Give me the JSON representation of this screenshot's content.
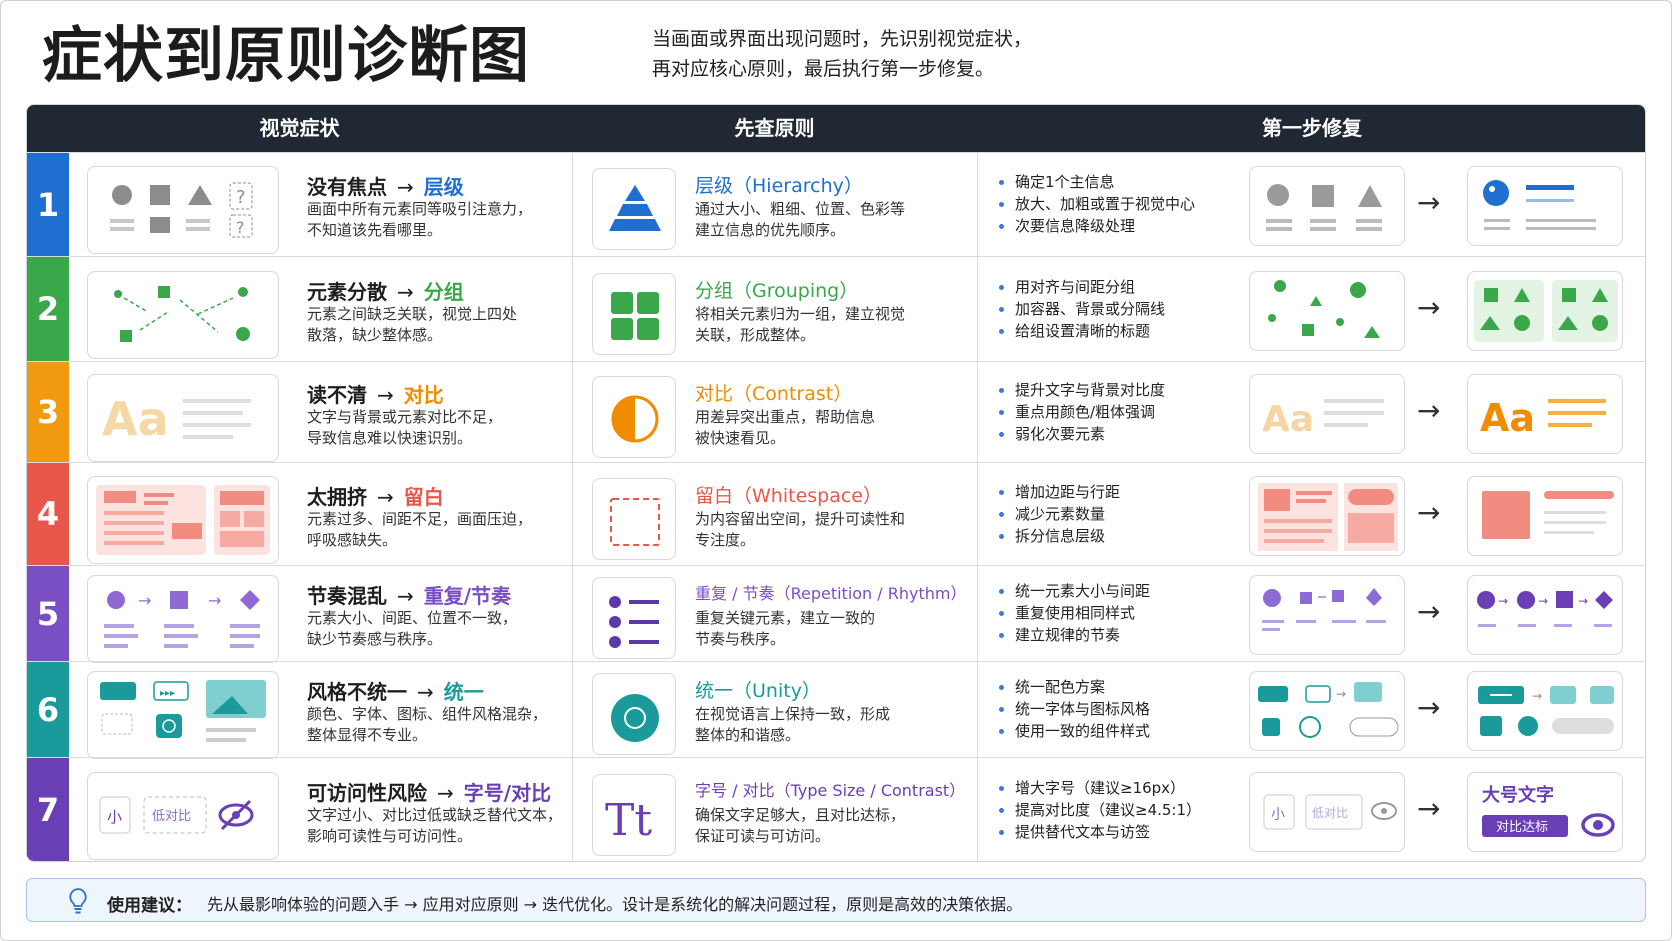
{
  "title": "症状到原则诊断图",
  "subtitle": [
    "当画面或界面出现问题时，先识别视觉症状，",
    "再对应核心原则，最后执行第一步修复。"
  ],
  "headers": {
    "symptom": "视觉症状",
    "principle": "先查原则",
    "fix": "第一步修复"
  },
  "rows": [
    {
      "num": "1",
      "color": "#1e6fd0",
      "accent": "#1e6fd0",
      "symptom": "没有焦点",
      "arrow": "→",
      "target": "层级",
      "desc": [
        "画面中所有元素同等吸引注意力，",
        "不知道该先看哪里。"
      ],
      "principle_name": "层级",
      "principle_en": "（Hierarchy）",
      "principle_desc": [
        "通过大小、粗细、位置、色彩等",
        "建立信息的优先顺序。"
      ],
      "fixes": [
        "确定1个主信息",
        "放大、加粗或置于视觉中心",
        "次要信息降级处理"
      ],
      "fix_arrow": "→"
    },
    {
      "num": "2",
      "color": "#3aa84a",
      "accent": "#3aa84a",
      "symptom": "元素分散",
      "arrow": "→",
      "target": "分组",
      "desc": [
        "元素之间缺乏关联，视觉上四处",
        "散落，缺少整体感。"
      ],
      "principle_name": "分组",
      "principle_en": "（Grouping）",
      "principle_desc": [
        "将相关元素归为一组，建立视觉",
        "关联，形成整体。"
      ],
      "fixes": [
        "用对齐与间距分组",
        "加容器、背景或分隔线",
        "给组设置清晰的标题"
      ],
      "fix_arrow": "→"
    },
    {
      "num": "3",
      "color": "#f29a0f",
      "accent": "#f08c00",
      "symptom": "读不清",
      "arrow": "→",
      "target": "对比",
      "desc": [
        "文字与背景或元素对比不足，",
        "导致信息难以快速识别。"
      ],
      "principle_name": "对比",
      "principle_en": "（Contrast）",
      "principle_desc": [
        "用差异突出重点，帮助信息",
        "被快速看见。"
      ],
      "fixes": [
        "提升文字与背景对比度",
        "重点用颜色/粗体强调",
        "弱化次要元素"
      ],
      "fix_arrow": "→",
      "aa": "Aa"
    },
    {
      "num": "4",
      "color": "#e8574a",
      "accent": "#e8574a",
      "symptom": "太拥挤",
      "arrow": "→",
      "target": "留白",
      "desc": [
        "元素过多、间距不足，画面压迫，",
        "呼吸感缺失。"
      ],
      "principle_name": "留白",
      "principle_en": "（Whitespace）",
      "principle_desc": [
        "为内容留出空间，提升可读性和",
        "专注度。"
      ],
      "fixes": [
        "增加边距与行距",
        "减少元素数量",
        "拆分信息层级"
      ],
      "fix_arrow": "→"
    },
    {
      "num": "5",
      "color": "#7b4fc4",
      "accent": "#7b4fc4",
      "symptom": "节奏混乱",
      "arrow": "→",
      "target": "重复/节奏",
      "desc": [
        "元素大小、间距、位置不一致，",
        "缺少节奏感与秩序。"
      ],
      "principle_name": "重复 / 节奏",
      "principle_en": "（Repetition / Rhythm）",
      "principle_desc": [
        "重复关键元素，建立一致的",
        "节奏与秩序。"
      ],
      "fixes": [
        "统一元素大小与间距",
        "重复使用相同样式",
        "建立规律的节奏"
      ],
      "fix_arrow": "→"
    },
    {
      "num": "6",
      "color": "#1a9a9a",
      "accent": "#1a9a9a",
      "symptom": "风格不统一",
      "arrow": "→",
      "target": "统一",
      "desc": [
        "颜色、字体、图标、组件风格混杂，",
        "整体显得不专业。"
      ],
      "principle_name": "统一",
      "principle_en": "（Unity）",
      "principle_desc": [
        "在视觉语言上保持一致，形成",
        "整体的和谐感。"
      ],
      "fixes": [
        "统一配色方案",
        "统一字体与图标风格",
        "使用一致的组件样式"
      ],
      "fix_arrow": "→"
    },
    {
      "num": "7",
      "color": "#6a3fb5",
      "accent": "#6a3fb5",
      "symptom": "可访问性风险",
      "arrow": "→",
      "target": "字号/对比",
      "desc": [
        "文字过小、对比过低或缺乏替代文本，",
        "影响可读性与可访问性。"
      ],
      "principle_name": "字号 / 对比",
      "principle_en": "（Type Size / Contrast）",
      "principle_desc": [
        "确保文字足够大，且对比达标，",
        "保证可读与可访问。"
      ],
      "fixes": [
        "增大字号（建议≥16px）",
        "提高对比度（建议≥4.5:1）",
        "提供替代文本与访签"
      ],
      "fix_arrow": "→",
      "small_label": "小",
      "low_contrast": "低对比",
      "big_text": "大号文字",
      "contrast_ok": "对比达标",
      "tt": "Tt"
    }
  ],
  "tip": {
    "label": "使用建议：",
    "text": "先从最影响体验的问题入手 → 应用对应原则 → 迭代优化。设计是系统化的解决问题过程，原则是高效的决策依据。"
  }
}
